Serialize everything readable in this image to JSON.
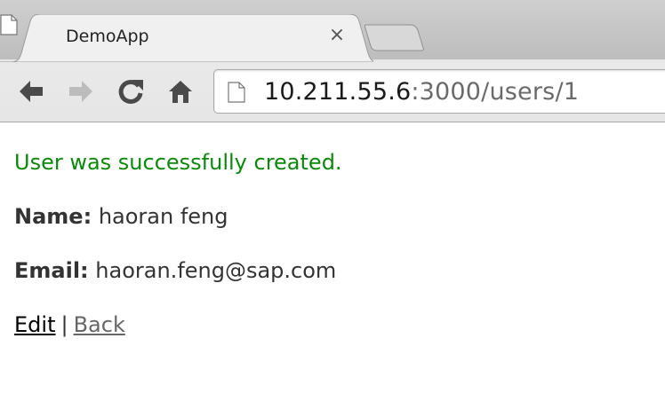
{
  "browser": {
    "tab_title": "DemoApp",
    "tab_close": "×",
    "url_host": "10.211.55.6",
    "url_rest": ":3000/users/1",
    "icons": {
      "tab_favicon": "page-icon",
      "back": "back-arrow-icon",
      "forward": "forward-arrow-icon",
      "reload": "reload-icon",
      "home": "home-icon",
      "omnibox_page": "page-icon"
    }
  },
  "page": {
    "notice": "User was successfully created.",
    "name_label": "Name:",
    "name_value": "haoran feng",
    "email_label": "Email:",
    "email_value": "haoran.feng@sap.com",
    "edit_link": "Edit",
    "separator": "|",
    "back_link": "Back"
  },
  "colors": {
    "notice": "#0a8a0a",
    "text": "#333333",
    "edit_link": "#000000",
    "back_link": "#666666"
  }
}
